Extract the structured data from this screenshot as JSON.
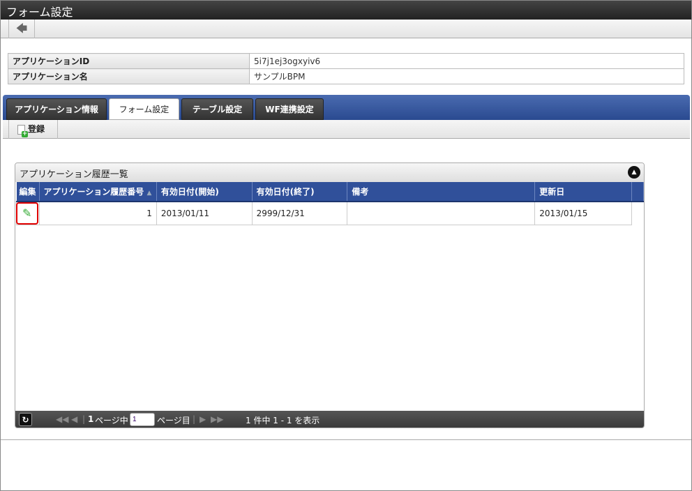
{
  "window": {
    "title": "フォーム設定"
  },
  "toolbar": {
    "back_icon": "arrow-left-icon"
  },
  "info": [
    {
      "label": "アプリケーションID",
      "value": "5i7j1ej3ogxyiv6"
    },
    {
      "label": "アプリケーション名",
      "value": "サンプルBPM"
    }
  ],
  "tabs": [
    {
      "label": "アプリケーション情報"
    },
    {
      "label": "フォーム設定",
      "active": true
    },
    {
      "label": "テーブル設定"
    },
    {
      "label": "WF連携設定"
    }
  ],
  "subtoolbar": {
    "register_label": "登録"
  },
  "panel": {
    "title": "アプリケーション履歴一覧",
    "columns": [
      "編集",
      "アプリケーション履歴番号",
      "有効日付(開始)",
      "有効日付(終了)",
      "備考",
      "更新日"
    ],
    "rows": [
      {
        "history_no": "1",
        "start": "2013/01/11",
        "end": "2999/12/31",
        "note": "",
        "updated": "2013/01/15"
      }
    ]
  },
  "pager": {
    "page_prefix": "1",
    "page_mid": "ページ中",
    "page_value": "1",
    "page_suffix": "ページ目",
    "summary": "1 件中 1 - 1 を表示"
  },
  "colors": {
    "tabbar": "#30509a",
    "highlight": "#e00000"
  }
}
